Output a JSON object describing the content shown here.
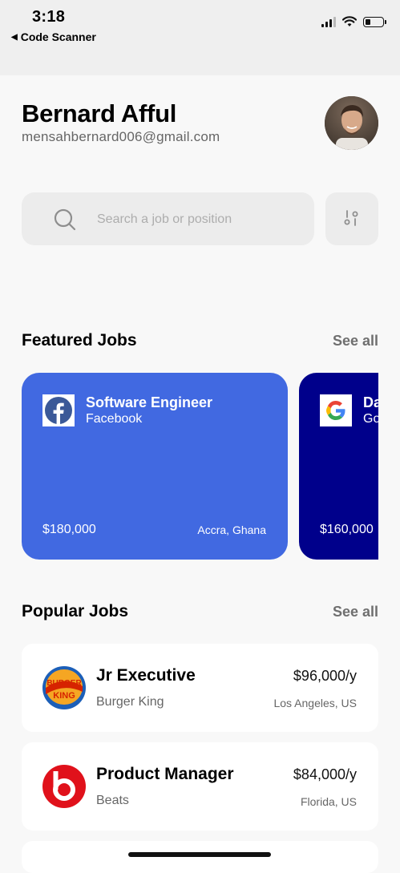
{
  "status_bar": {
    "time": "3:18",
    "back_app": "Code Scanner",
    "back_arrow": "◀"
  },
  "profile": {
    "name": "Bernard Afful",
    "email": "mensahbernard006@gmail.com"
  },
  "search": {
    "placeholder": "Search a job or position",
    "value": ""
  },
  "featured": {
    "title": "Featured Jobs",
    "see_all": "See all",
    "cards": [
      {
        "title": "Software Engineer",
        "company": "Facebook",
        "salary": "$180,000",
        "location": "Accra, Ghana",
        "color": "#4169E1",
        "icon": "facebook-logo-icon"
      },
      {
        "title": "Da",
        "company": "Go",
        "salary": "$160,000",
        "location": "",
        "color": "#00008B",
        "icon": "google-logo-icon"
      }
    ]
  },
  "popular": {
    "title": "Popular Jobs",
    "see_all": "See all",
    "items": [
      {
        "title": "Jr Executive",
        "company": "Burger King",
        "salary": "$96,000/y",
        "location": "Los Angeles, US",
        "icon": "burger-king-logo-icon"
      },
      {
        "title": "Product Manager",
        "company": "Beats",
        "salary": "$84,000/y",
        "location": "Florida, US",
        "icon": "beats-logo-icon"
      }
    ]
  },
  "colors": {
    "featured_primary": "#4169E1",
    "featured_secondary": "#00008B",
    "background": "#f8f8f8"
  }
}
